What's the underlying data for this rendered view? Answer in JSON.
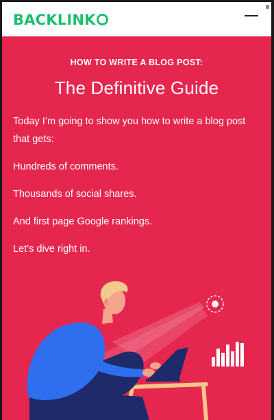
{
  "header": {
    "logo_text": "BACKLINK",
    "logo_suffix": "O",
    "menu_icon": "hamburger-menu-icon"
  },
  "hero": {
    "kicker": "HOW TO WRITE A BLOG POST:",
    "title": "The Definitive Guide",
    "paragraphs": [
      "Today I’m going to show you how to write a blog post that gets:",
      "Hundreds of comments.",
      "Thousands of social shares.",
      "And first page Google rankings.",
      "Let’s dive right in."
    ]
  },
  "colors": {
    "brand_green": "#1bbf6b",
    "hero_background": "#e5274f",
    "shirt_blue": "#2e6ff0",
    "pants_navy": "#1f2a6b",
    "hair": "#f3c98e"
  }
}
